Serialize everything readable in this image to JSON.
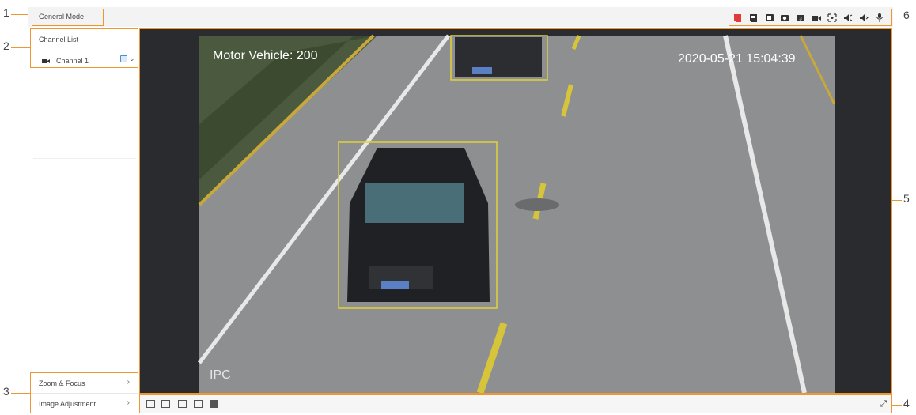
{
  "header": {
    "mode_label": "General Mode"
  },
  "sidebar": {
    "channel_list_title": "Channel List",
    "channel_name": "Channel 1",
    "menu": [
      {
        "label": "Zoom & Focus"
      },
      {
        "label": "Image Adjustment"
      }
    ]
  },
  "video": {
    "counter_text": "Motor Vehicle: 200",
    "timestamp": "2020-05-21 15:04:39",
    "watermark": "IPC"
  },
  "callouts": [
    "1",
    "2",
    "3",
    "4",
    "5",
    "6"
  ],
  "toolbar": {
    "icons": [
      "alarm-icon",
      "record-icon",
      "snapshot-icon",
      "camera-icon",
      "triple-snapshot-icon",
      "video-icon",
      "zoom-icon",
      "audio-out-icon",
      "audio-in-icon",
      "microphone-icon"
    ]
  },
  "colors": {
    "accent": "#f0962f",
    "icon_red": "#e03a3a",
    "icon_dark": "#333333"
  }
}
